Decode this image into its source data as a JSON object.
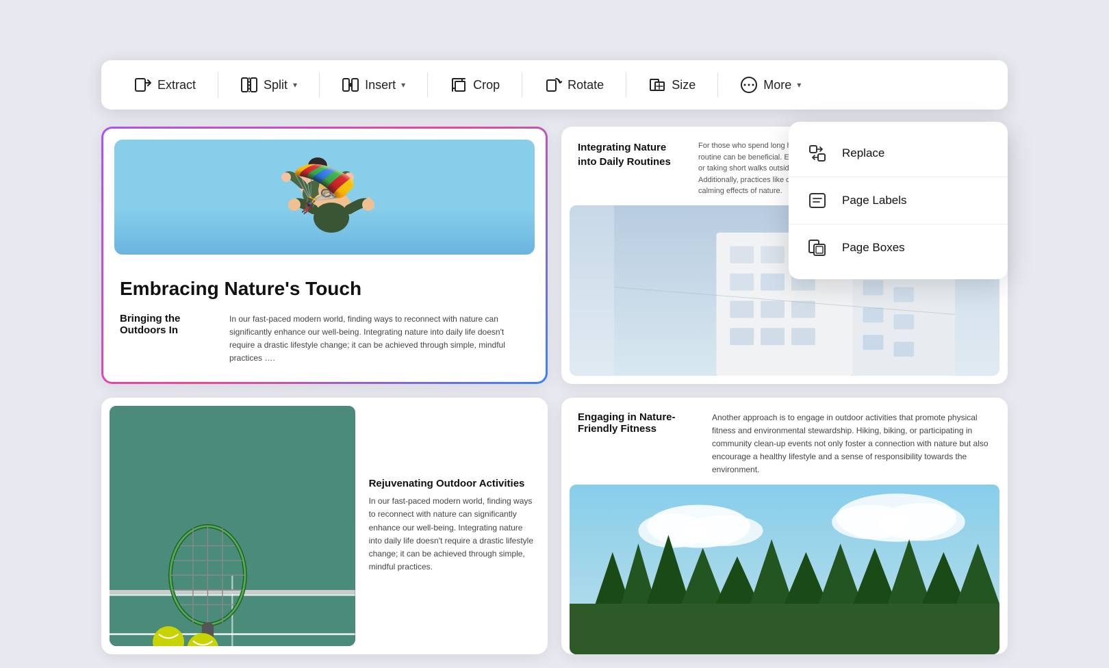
{
  "toolbar": {
    "items": [
      {
        "id": "extract",
        "label": "Extract",
        "icon": "extract",
        "hasChevron": false
      },
      {
        "id": "split",
        "label": "Split",
        "icon": "split",
        "hasChevron": true
      },
      {
        "id": "insert",
        "label": "Insert",
        "icon": "insert",
        "hasChevron": true
      },
      {
        "id": "crop",
        "label": "Crop",
        "icon": "crop",
        "hasChevron": false
      },
      {
        "id": "rotate",
        "label": "Rotate",
        "icon": "rotate",
        "hasChevron": false
      },
      {
        "id": "size",
        "label": "Size",
        "icon": "size",
        "hasChevron": false
      },
      {
        "id": "more",
        "label": "More",
        "icon": "more",
        "hasChevron": true
      }
    ]
  },
  "dropdown": {
    "items": [
      {
        "id": "replace",
        "label": "Replace",
        "icon": "replace"
      },
      {
        "id": "page-labels",
        "label": "Page Labels",
        "icon": "page-labels"
      },
      {
        "id": "page-boxes",
        "label": "Page Boxes",
        "icon": "page-boxes"
      }
    ]
  },
  "cards": {
    "top_left": {
      "title": "Embracing Nature's Touch",
      "section_title": "Bringing the Outdoors In",
      "body_text": "In our fast-paced modern world, finding ways to reconnect with nature can significantly enhance our well-being. Integrating nature into daily life doesn't require a drastic lifestyle change; it can be achieved through simple, mindful practices …."
    },
    "top_right": {
      "section_title": "Integrating Nature into Daily Routines",
      "body_text": "For those who spend long hours indoors, incorporating natural elements into your daily routine can be beneficial. Even small changes, like placing plants near your workspace or taking short walks outside during breaks, can make a significant difference. Additionally, practices like deep breathing exercises or meditation can help simulate the calming effects of nature."
    },
    "bottom_left": {
      "section_title": "Rejuvenating Outdoor Activities",
      "body_text": "In our fast-paced modern world, finding ways to reconnect with nature can significantly enhance our well-being. Integrating nature into daily life doesn't require a drastic lifestyle change; it can be achieved through simple, mindful practices."
    },
    "bottom_right": {
      "section_title": "Engaging in Nature-Friendly Fitness",
      "body_text": "Another approach is to engage in outdoor activities that promote physical fitness and environmental stewardship. Hiking, biking, or participating in community clean-up events not only foster a connection with nature but also encourage a healthy lifestyle and a sense of responsibility towards the environment."
    }
  }
}
